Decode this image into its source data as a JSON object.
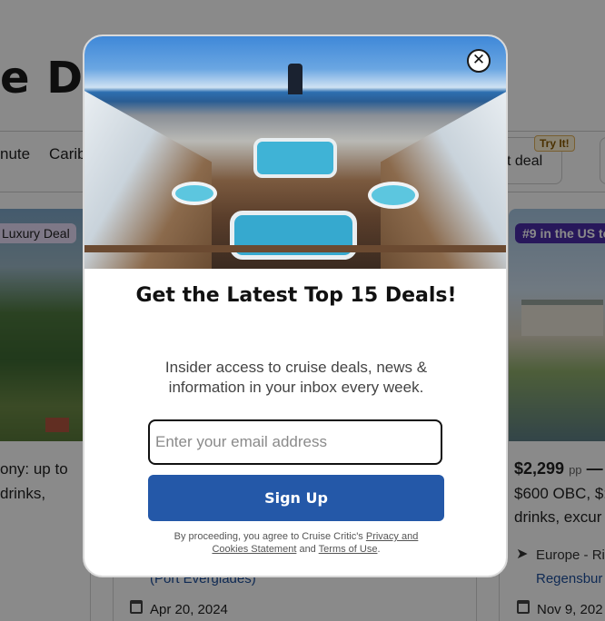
{
  "site": {
    "title_fragment": "e D"
  },
  "nav": {
    "chips": [
      "nute",
      "Carib"
    ],
    "deal_chip_label": "t deal",
    "deal_chip_badge": "Try It!"
  },
  "cards": {
    "left": {
      "badge": "Luxury Deal",
      "line1": "ony: up to",
      "line2": "drinks,"
    },
    "middle": {
      "port": "(Port Everglades)",
      "date": "Apr 20, 2024"
    },
    "right": {
      "badge": "#9 in the US to",
      "price": "$2,299",
      "price_unit": "pp",
      "price_dash": "—",
      "line2": "$600 OBC, $:",
      "line3": "drinks, excur",
      "itinerary": "Europe - Ri",
      "itinerary_link": "Regensbur",
      "date": "Nov 9, 202"
    }
  },
  "modal": {
    "close_symbol": "✕",
    "title": "Get the Latest Top 15 Deals!",
    "subtitle": "Insider access to cruise deals, news & information in your inbox every week.",
    "email_placeholder": "Enter your email address",
    "email_value": "",
    "signup_label": "Sign Up",
    "legal": {
      "prefix": "By proceeding, you agree to Cruise Critic's ",
      "privacy_link": "Privacy and Cookies Statement",
      "middle": " and ",
      "terms_link": "Terms of Use",
      "suffix": "."
    }
  },
  "icons": {
    "close": "close-icon",
    "location": "location-arrow-icon",
    "calendar": "calendar-icon"
  },
  "colors": {
    "signup_button": "#2458a8",
    "badge_purple": "#4b2ea8",
    "badge_lavender": "#e9defa",
    "link_blue": "#1d4f9c",
    "overlay": "rgba(0,0,0,0.46)"
  }
}
